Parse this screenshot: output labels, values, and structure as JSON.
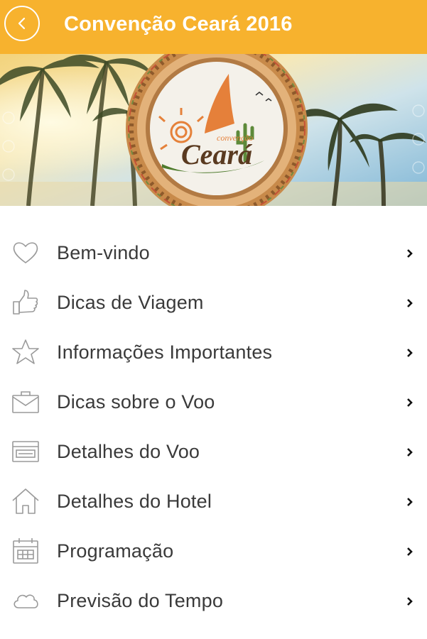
{
  "app_bar": {
    "title": "Convenção Ceará 2016",
    "background": "#f7b22e"
  },
  "hero": {
    "logo_small_text": "convenção",
    "logo_big_text": "Ceará"
  },
  "menu": {
    "items": [
      {
        "label": "Bem-vindo",
        "icon": "heart-icon"
      },
      {
        "label": "Dicas de Viagem",
        "icon": "thumbs-up-icon"
      },
      {
        "label": "Informações Importantes",
        "icon": "star-icon"
      },
      {
        "label": "Dicas sobre o Voo",
        "icon": "briefcase-icon"
      },
      {
        "label": "Detalhes do Voo",
        "icon": "ticket-icon"
      },
      {
        "label": "Detalhes do Hotel",
        "icon": "house-icon"
      },
      {
        "label": "Programação",
        "icon": "calendar-icon"
      },
      {
        "label": "Previsão do Tempo",
        "icon": "cloud-icon"
      }
    ]
  }
}
